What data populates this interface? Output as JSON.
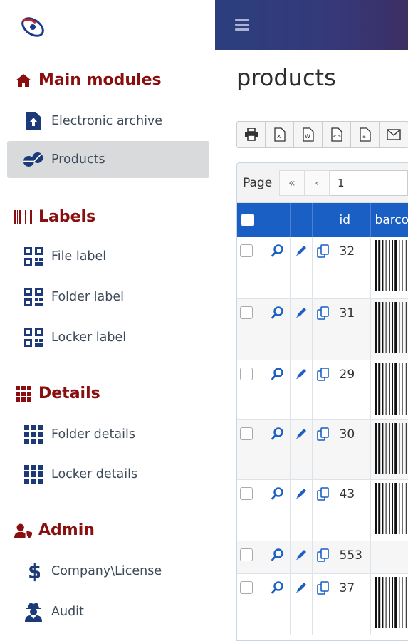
{
  "header": {
    "menu_icon": "hamburger-icon"
  },
  "sidebar": {
    "sections": [
      {
        "title": "Main modules",
        "icon": "home-icon",
        "items": [
          {
            "label": "Electronic archive",
            "icon": "file-upload-icon"
          },
          {
            "label": "Products",
            "icon": "pills-icon",
            "active": true
          }
        ]
      },
      {
        "title": "Labels",
        "icon": "barcode-icon",
        "items": [
          {
            "label": "File label",
            "icon": "qrcode-icon"
          },
          {
            "label": "Folder label",
            "icon": "qrcode-icon"
          },
          {
            "label": "Locker label",
            "icon": "qrcode-icon"
          }
        ]
      },
      {
        "title": "Details",
        "icon": "grid-icon",
        "items": [
          {
            "label": "Folder details",
            "icon": "grid-icon"
          },
          {
            "label": "Locker details",
            "icon": "grid-icon"
          }
        ]
      },
      {
        "title": "Admin",
        "icon": "user-shield-icon",
        "items": [
          {
            "label": "Company\\License",
            "icon": "dollar-icon"
          },
          {
            "label": "Audit",
            "icon": "user-secret-icon"
          }
        ]
      }
    ]
  },
  "main": {
    "title": "products",
    "toolbar": [
      "print-icon",
      "excel-export-icon",
      "word-export-icon",
      "xml-export-icon",
      "text-export-icon",
      "email-icon"
    ],
    "pager": {
      "label": "Page",
      "first": "«",
      "prev": "‹",
      "current_page": "1"
    },
    "table": {
      "columns": [
        "",
        "",
        "",
        "",
        "id",
        "barco"
      ],
      "rows": [
        {
          "id": "32",
          "barcode": true
        },
        {
          "id": "31",
          "barcode": true
        },
        {
          "id": "29",
          "barcode": true
        },
        {
          "id": "30",
          "barcode": true
        },
        {
          "id": "43",
          "barcode": true
        },
        {
          "id": "553",
          "barcode": false
        },
        {
          "id": "37",
          "barcode": true
        }
      ]
    }
  },
  "colors": {
    "accent": "#1a5fc4",
    "section_title": "#8b0e0e",
    "icon": "#1c3a78",
    "topbar": "#2b3f7e"
  }
}
